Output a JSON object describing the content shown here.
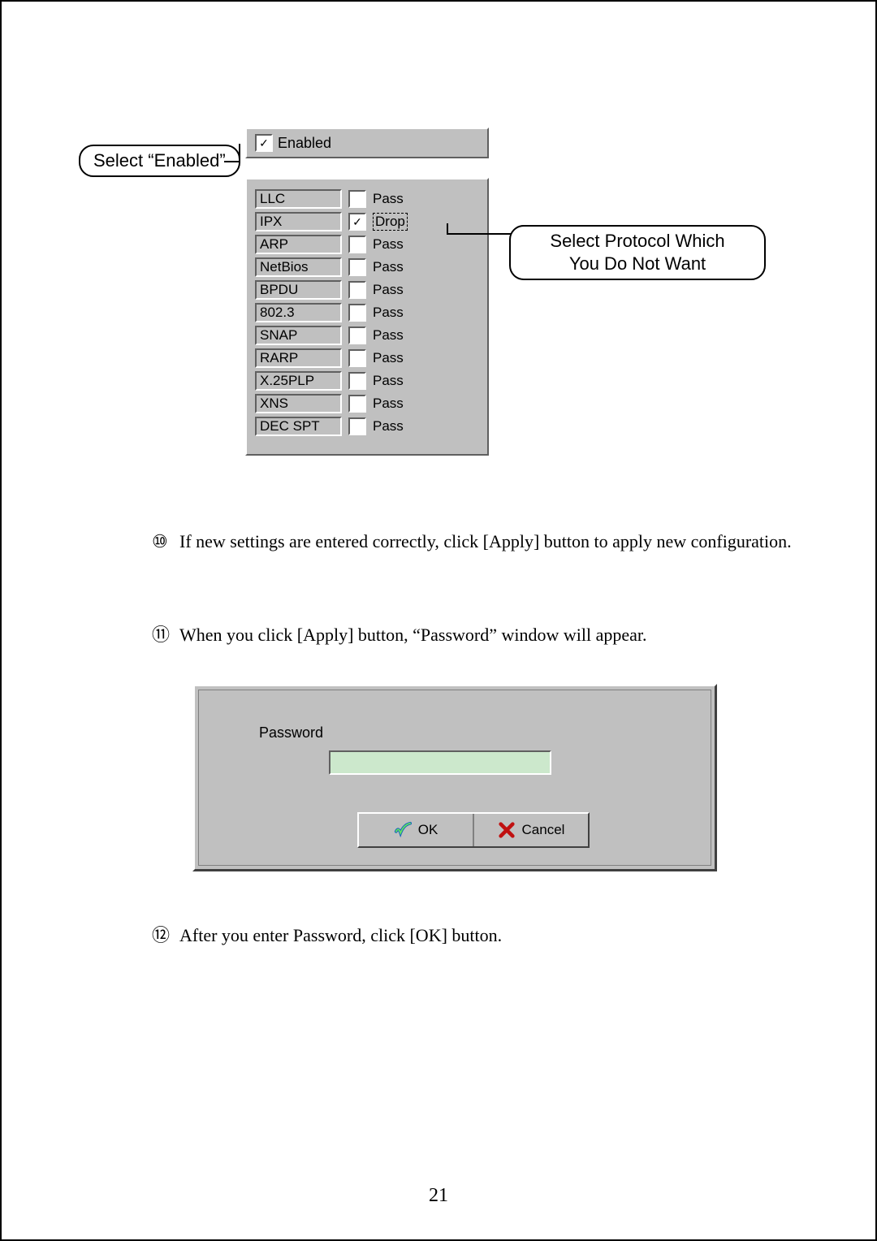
{
  "callouts": {
    "select_enabled": "Select “Enabled”",
    "select_protocol_line1": "Select Protocol Which",
    "select_protocol_line2": "You Do Not Want"
  },
  "enabled_panel": {
    "enabled_label": "Enabled",
    "enabled_checked": true
  },
  "protocols": [
    {
      "name": "LLC",
      "label": "Pass",
      "checked": false
    },
    {
      "name": "IPX",
      "label": "Drop",
      "checked": true
    },
    {
      "name": "ARP",
      "label": "Pass",
      "checked": false
    },
    {
      "name": "NetBios",
      "label": "Pass",
      "checked": false
    },
    {
      "name": "BPDU",
      "label": "Pass",
      "checked": false
    },
    {
      "name": "802.3",
      "label": "Pass",
      "checked": false
    },
    {
      "name": "SNAP",
      "label": "Pass",
      "checked": false
    },
    {
      "name": "RARP",
      "label": "Pass",
      "checked": false
    },
    {
      "name": "X.25PLP",
      "label": "Pass",
      "checked": false
    },
    {
      "name": "XNS",
      "label": "Pass",
      "checked": false
    },
    {
      "name": "DEC SPT",
      "label": "Pass",
      "checked": false
    }
  ],
  "items": {
    "n10": "⑩",
    "t10": "If new settings are entered correctly, click [Apply] button to apply new configuration.",
    "n11": "⑪",
    "t11": "When you click [Apply] button, “Password” window will appear.",
    "n12": "⑫",
    "t12": "After you enter Password, click [OK] button."
  },
  "dialog": {
    "password_label": "Password",
    "ok_label": "OK",
    "cancel_label": "Cancel"
  },
  "page_number": "21"
}
